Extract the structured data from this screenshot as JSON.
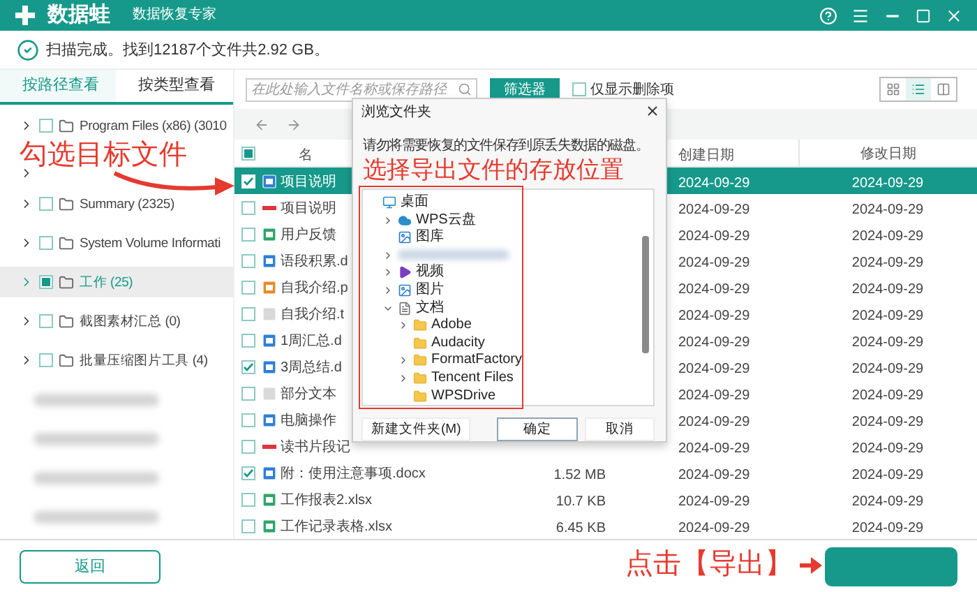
{
  "app": {
    "logo": "数据蛙",
    "subtitle": "数据恢复专家"
  },
  "status": "扫描完成。找到12187个文件共2.92 GB。",
  "view_tabs": [
    {
      "label": "按路径查看",
      "selected": true
    },
    {
      "label": "按类型查看",
      "selected": false
    }
  ],
  "search": {
    "placeholder": "在此处输入文件名称或保存路径"
  },
  "filter_button": "筛选器",
  "deleted_only": {
    "label": "仅显示删除项",
    "checked": false
  },
  "view_modes": [
    {
      "kind": "grid",
      "selected": false
    },
    {
      "kind": "list",
      "selected": true
    },
    {
      "kind": "columns",
      "selected": false
    }
  ],
  "folders": [
    {
      "kind": "folder",
      "label": "Program Files (x86) (3010",
      "checked": false,
      "partial": false,
      "selected": false
    },
    {
      "kind": "covered"
    },
    {
      "kind": "folder",
      "label": "Summary (2325)",
      "checked": false,
      "partial": false,
      "selected": false
    },
    {
      "kind": "folder",
      "label": "System Volume Informati",
      "checked": false,
      "partial": false,
      "selected": false
    },
    {
      "kind": "folder",
      "label": "工作 (25)",
      "checked": false,
      "partial": true,
      "selected": true
    },
    {
      "kind": "folder",
      "label": "截图素材汇总 (0)",
      "checked": false,
      "partial": false,
      "selected": false
    },
    {
      "kind": "folder",
      "label": "批量压缩图片工具 (4)",
      "checked": false,
      "partial": false,
      "selected": false
    },
    {
      "kind": "blurred"
    },
    {
      "kind": "blurred"
    },
    {
      "kind": "blurred"
    },
    {
      "kind": "blurred"
    }
  ],
  "table": {
    "select_all": {
      "partial": true
    },
    "columns": {
      "name": "名",
      "created": "创建日期",
      "modified": "修改日期"
    },
    "rows": [
      {
        "name": "项目说明",
        "kind": "word",
        "checked": true,
        "selected": true,
        "created": "2024-09-29",
        "modified": "2024-09-29"
      },
      {
        "name": "项目说明",
        "kind": "pdf",
        "checked": false,
        "selected": false,
        "created": "2024-09-29",
        "modified": "2024-09-29"
      },
      {
        "name": "用户反馈",
        "kind": "excel",
        "checked": false,
        "selected": false,
        "created": "2024-09-29",
        "modified": "2024-09-29"
      },
      {
        "name": "语段积累.d",
        "kind": "word",
        "checked": false,
        "selected": false,
        "created": "2024-09-29",
        "modified": "2024-09-29"
      },
      {
        "name": "自我介绍.p",
        "kind": "ppt",
        "checked": false,
        "selected": false,
        "created": "2024-09-29",
        "modified": "2024-09-29"
      },
      {
        "name": "自我介绍.t",
        "kind": "txt",
        "checked": false,
        "selected": false,
        "created": "2024-09-29",
        "modified": "2024-09-29"
      },
      {
        "name": "1周汇总.d",
        "kind": "word",
        "checked": false,
        "selected": false,
        "created": "2024-09-29",
        "modified": "2024-09-29"
      },
      {
        "name": "3周总结.d",
        "kind": "word",
        "checked": true,
        "selected": false,
        "created": "2024-09-29",
        "modified": "2024-09-29"
      },
      {
        "name": "部分文本",
        "kind": "txt",
        "checked": false,
        "selected": false,
        "created": "2024-09-29",
        "modified": "2024-09-29"
      },
      {
        "name": "电脑操作",
        "kind": "word",
        "checked": false,
        "selected": false,
        "created": "2024-09-29",
        "modified": "2024-09-29"
      },
      {
        "name": "读书片段记",
        "kind": "pdf",
        "checked": false,
        "selected": false,
        "created": "2024-09-29",
        "modified": "2024-09-29"
      },
      {
        "name": "附：使用注意事项.docx",
        "kind": "word",
        "checked": true,
        "selected": false,
        "size": "1.52 MB",
        "created": "2024-09-29",
        "modified": "2024-09-29"
      },
      {
        "name": "工作报表2.xlsx",
        "kind": "excel",
        "checked": false,
        "selected": false,
        "size": "10.7 KB",
        "created": "2024-09-29",
        "modified": "2024-09-29"
      },
      {
        "name": "工作记录表格.xlsx",
        "kind": "excel",
        "checked": false,
        "selected": false,
        "size": "6.45 KB",
        "created": "2024-09-29",
        "modified": "2024-09-29"
      }
    ]
  },
  "dialog": {
    "title": "浏览文件夹",
    "warning": "请勿将需要恢复的文件保存到原丢失数据的磁盘。",
    "tree": [
      {
        "kind": "desktop",
        "label": "桌面",
        "children": [
          {
            "kind": "cloud",
            "label": "WPS云盘",
            "expanded": false
          },
          {
            "kind": "gallery",
            "label": "图库"
          },
          {
            "kind": "blurred",
            "expanded": false
          },
          {
            "kind": "video",
            "label": "视频",
            "expanded": false
          },
          {
            "kind": "pictures",
            "label": "图片",
            "expanded": false
          },
          {
            "kind": "documents",
            "label": "文档",
            "expanded": true,
            "children": [
              {
                "kind": "folder",
                "label": "Adobe",
                "expanded": false
              },
              {
                "kind": "folder",
                "label": "Audacity"
              },
              {
                "kind": "folder",
                "label": "FormatFactory",
                "expanded": false
              },
              {
                "kind": "folder",
                "label": "Tencent Files",
                "expanded": false
              },
              {
                "kind": "folder",
                "label": "WPSDrive"
              }
            ]
          }
        ]
      }
    ],
    "buttons": [
      {
        "label": "新建文件夹(M)",
        "default": false
      },
      {
        "label": "确定",
        "default": true
      },
      {
        "label": "取消",
        "default": false
      }
    ]
  },
  "bottom": {
    "back_button": "返回"
  },
  "annotations": {
    "pick_files": "勾选目标文件",
    "choose_location": "选择导出文件的存放位置",
    "click_export": "点击【导出】"
  }
}
